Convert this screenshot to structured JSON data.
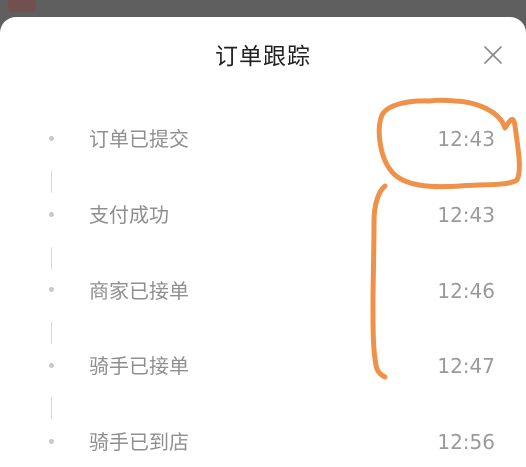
{
  "sheet": {
    "title": "订单跟踪",
    "close_icon": "close-icon"
  },
  "timeline": {
    "steps": [
      {
        "label": "订单已提交",
        "time": "12:43"
      },
      {
        "label": "支付成功",
        "time": "12:43"
      },
      {
        "label": "商家已接单",
        "time": "12:46"
      },
      {
        "label": "骑手已接单",
        "time": "12:47"
      },
      {
        "label": "骑手已到店",
        "time": "12:56"
      }
    ]
  },
  "annotation": {
    "color": "#f0914a",
    "shapes": [
      "circle-around-first-time",
      "vertical-stroke"
    ]
  }
}
